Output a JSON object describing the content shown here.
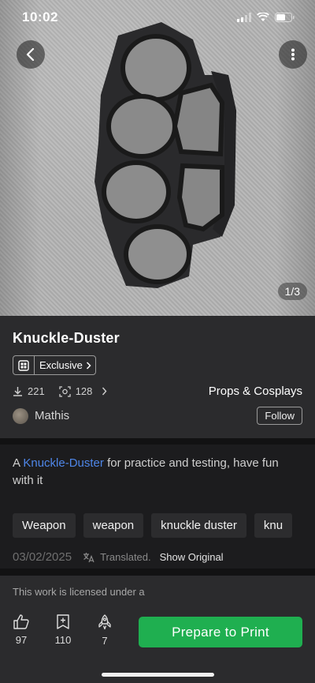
{
  "status_bar": {
    "time": "10:02"
  },
  "gallery": {
    "pager": "1/3"
  },
  "model": {
    "title": "Knuckle-Duster",
    "exclusive_label": "Exclusive",
    "downloads": "221",
    "prints": "128",
    "category": "Props & Cosplays",
    "author": "Mathis",
    "follow_label": "Follow"
  },
  "description": {
    "prefix": "A ",
    "link": "Knuckle-Duster",
    "suffix": " for practice and testing, have fun with it"
  },
  "tags": [
    "Weapon",
    "weapon",
    "knuckle duster",
    "knu"
  ],
  "meta": {
    "date": "03/02/2025",
    "translated": "Translated.",
    "show_original": "Show Original"
  },
  "license": {
    "text": "This work is licensed under a"
  },
  "actions": [
    {
      "icon": "thumbs-up-icon",
      "count": "97"
    },
    {
      "icon": "bookmark-plus-icon",
      "count": "110"
    },
    {
      "icon": "rocket-icon",
      "count": "7"
    }
  ],
  "print_button": {
    "label": "Prepare to Print"
  },
  "colors": {
    "accent_green": "#1faf50",
    "link_blue": "#4e86e8",
    "panel": "#2b2b2d",
    "background": "#1c1c1e"
  }
}
